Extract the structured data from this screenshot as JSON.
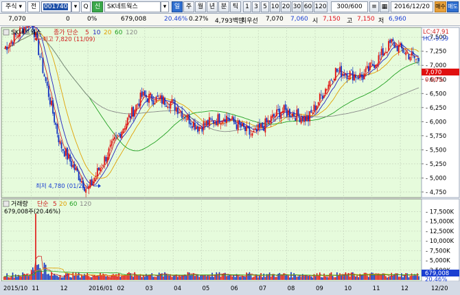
{
  "toolbar": {
    "type_label": "주식",
    "type_arrow": "▾",
    "jeon_label": "전",
    "code_value": "001740",
    "code_arrow": "▾",
    "q_label": "Q",
    "sin_label": "신",
    "name_value": "SK네트웍스",
    "name_arrow": "▾",
    "periods": [
      "일",
      "주",
      "월",
      "년",
      "분",
      "틱"
    ],
    "minutes": [
      "1",
      "3",
      "5",
      "10",
      "20",
      "30",
      "60",
      "120"
    ],
    "count_value": "300",
    "count_total": "/600",
    "date_value": "2016/12/20",
    "buy_label": "매수",
    "sell_label": "매도"
  },
  "quote": {
    "price": "7,070",
    "change": "0",
    "change_pct": "0%",
    "volume": "679,008",
    "turnover_pct": "20.46%",
    "rate": "0.27%",
    "amount": "4,793백만",
    "best_label": "최우선",
    "ask": "7,070",
    "bid": "7,060",
    "open_label": "시",
    "open": "7,150",
    "high_label": "고",
    "high": "7,150",
    "low_label": "저",
    "low": "6,960"
  },
  "price_pane": {
    "name": "SK네트웍스",
    "indicator_label": "종가 단순",
    "ma_periods": [
      "5",
      "10",
      "20",
      "60",
      "120"
    ],
    "ma_colors": [
      "#d02020",
      "#2020c0",
      "#e0a000",
      "#20a020",
      "#888888"
    ],
    "lc_label": "LC:47.91",
    "hc_label": "HC:-9.59",
    "current_price_tag": "7,070",
    "current_pct_tag": "0.00%",
    "max_label": "최고 7,820 (11/09)",
    "min_label": "최저 4,780 (01/21)",
    "y_ticks": [
      "7,500",
      "7,250",
      "7,000",
      "6,750",
      "6,500",
      "6,250",
      "6,000",
      "5,750",
      "5,500",
      "5,250",
      "5,000",
      "4,750"
    ]
  },
  "volume_pane": {
    "title": "거래량",
    "ma_label": "단순",
    "ma_periods": [
      "5",
      "20",
      "60",
      "120"
    ],
    "current_label": "679,008주(20.46%)",
    "current_tag": "679,008",
    "current_pct_tag": "20.46%",
    "y_ticks": [
      "17,500K",
      "15,000K",
      "12,500K",
      "10,000K",
      "7,500K",
      "5,000K",
      "2,500K"
    ]
  },
  "x_axis": {
    "labels": [
      "2015/10",
      "11",
      "12",
      "2016/01",
      "02",
      "03",
      "04",
      "05",
      "06",
      "07",
      "08",
      "09",
      "10",
      "11",
      "12",
      "12/20"
    ]
  },
  "colors": {
    "up": "#e01010",
    "down": "#1030c0",
    "pane_bg": "#e6fbdc",
    "grid": "#b8c8b0"
  },
  "chart_data": {
    "type": "candlestick",
    "title": "SK네트웍스",
    "x_range": [
      "2015/10",
      "2016/12/20"
    ],
    "ylim": [
      4700,
      7600
    ],
    "price_points": [
      {
        "x": "2015/10",
        "close": 7300
      },
      {
        "x": "11/09",
        "close": 7820
      },
      {
        "x": "12",
        "close": 5600
      },
      {
        "x": "01/21",
        "close": 4780
      },
      {
        "x": "02",
        "close": 5650
      },
      {
        "x": "03",
        "close": 6450
      },
      {
        "x": "04",
        "close": 6350
      },
      {
        "x": "05",
        "close": 5900
      },
      {
        "x": "06",
        "close": 6100
      },
      {
        "x": "07",
        "close": 5750
      },
      {
        "x": "08",
        "close": 6200
      },
      {
        "x": "09",
        "close": 6050
      },
      {
        "x": "10",
        "close": 6900
      },
      {
        "x": "11",
        "close": 6800
      },
      {
        "x": "12",
        "close": 7400
      },
      {
        "x": "12/20",
        "close": 7070
      }
    ],
    "volume_ylim": [
      0,
      19000000
    ],
    "volume_peak": 17000000
  }
}
